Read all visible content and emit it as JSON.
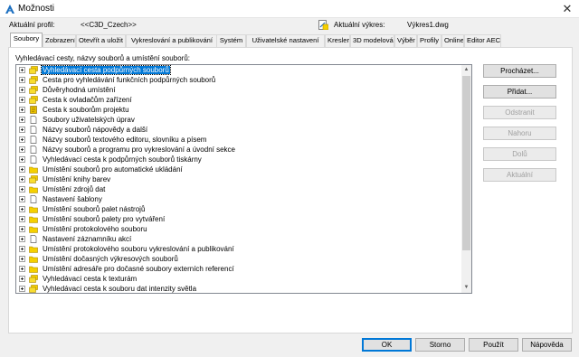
{
  "window": {
    "title": "Možnosti",
    "close_glyph": "✕",
    "logo_icon": "autocad-logo-icon"
  },
  "profile": {
    "label": "Aktuální profil:",
    "value": "<<C3D_Czech>>",
    "drawing_label": "Aktuální výkres:",
    "drawing_value": "Výkres1.dwg"
  },
  "tabs": [
    "Soubory",
    "Zobrazení",
    "Otevřít a uložit",
    "Vykreslování a publikování",
    "Systém",
    "Uživatelské nastavení",
    "Kreslení",
    "3D modelování",
    "Výběr",
    "Profily",
    "Online",
    "Editor AEC"
  ],
  "active_tab": "Soubory",
  "tree_caption": "Vyhledávací cesty, názvy souborů a umístění souborů:",
  "tree_items": [
    {
      "label": "Vyhledávací cesta podpůrných souborů",
      "icon": "folder-stack-icon"
    },
    {
      "label": "Cesta pro vyhledávání funkčních podpůrných souborů",
      "icon": "folder-stack-icon"
    },
    {
      "label": "Důvěryhodná umístění",
      "icon": "folder-stack-icon"
    },
    {
      "label": "Cesta k ovladačům zařízení",
      "icon": "folder-stack-icon"
    },
    {
      "label": "Cesta k souborům projektu",
      "icon": "project-book-icon"
    },
    {
      "label": "Soubory uživatelských úprav",
      "icon": "document-icon"
    },
    {
      "label": "Názvy souborů nápovědy a další",
      "icon": "document-icon"
    },
    {
      "label": "Názvy souborů textového editoru, slovníku a písem",
      "icon": "document-icon"
    },
    {
      "label": "Názvy souborů a programu pro vykreslování a úvodní sekce",
      "icon": "document-icon"
    },
    {
      "label": "Vyhledávací cesta k podpůrných souborů tiskárny",
      "icon": "document-icon"
    },
    {
      "label": "Umístění souborů pro automatické ukládání",
      "icon": "folder-icon"
    },
    {
      "label": "Umístění knihy barev",
      "icon": "folder-stack-icon"
    },
    {
      "label": "Umístění zdrojů dat",
      "icon": "folder-icon"
    },
    {
      "label": "Nastavení šablony",
      "icon": "document-icon"
    },
    {
      "label": "Umístění souborů palet nástrojů",
      "icon": "folder-icon"
    },
    {
      "label": "Umístění souborů palety pro vytváření",
      "icon": "folder-icon"
    },
    {
      "label": "Umístění protokolového souboru",
      "icon": "folder-icon"
    },
    {
      "label": "Nastavení záznamníku akcí",
      "icon": "document-icon"
    },
    {
      "label": "Umístění protokolového souboru vykreslování a publikování",
      "icon": "folder-icon"
    },
    {
      "label": "Umístění dočasných výkresových souborů",
      "icon": "folder-icon"
    },
    {
      "label": "Umístění adresáře pro dočasné soubory externích referencí",
      "icon": "folder-icon"
    },
    {
      "label": "Vyhledávací cesta k texturám",
      "icon": "folder-stack-icon"
    },
    {
      "label": "Vyhledávací cesta k souboru dat intenzity světla",
      "icon": "folder-stack-icon"
    }
  ],
  "selected_index": 0,
  "side_buttons": [
    {
      "label": "Procházet...",
      "enabled": true
    },
    {
      "label": "Přidat...",
      "enabled": true
    },
    {
      "label": "Odstranit",
      "enabled": false
    },
    {
      "label": "Nahoru",
      "enabled": false
    },
    {
      "label": "Dolů",
      "enabled": false
    },
    {
      "label": "Aktuální",
      "enabled": false
    }
  ],
  "bottom_buttons": [
    {
      "label": "OK",
      "name": "ok-button"
    },
    {
      "label": "Storno",
      "name": "cancel-button"
    },
    {
      "label": "Použít",
      "name": "apply-button"
    },
    {
      "label": "Nápověda",
      "name": "help-button"
    }
  ],
  "colors": {
    "selection": "#0078d7",
    "folder": "#f5d000",
    "accent_blue": "#1c6fc0"
  }
}
